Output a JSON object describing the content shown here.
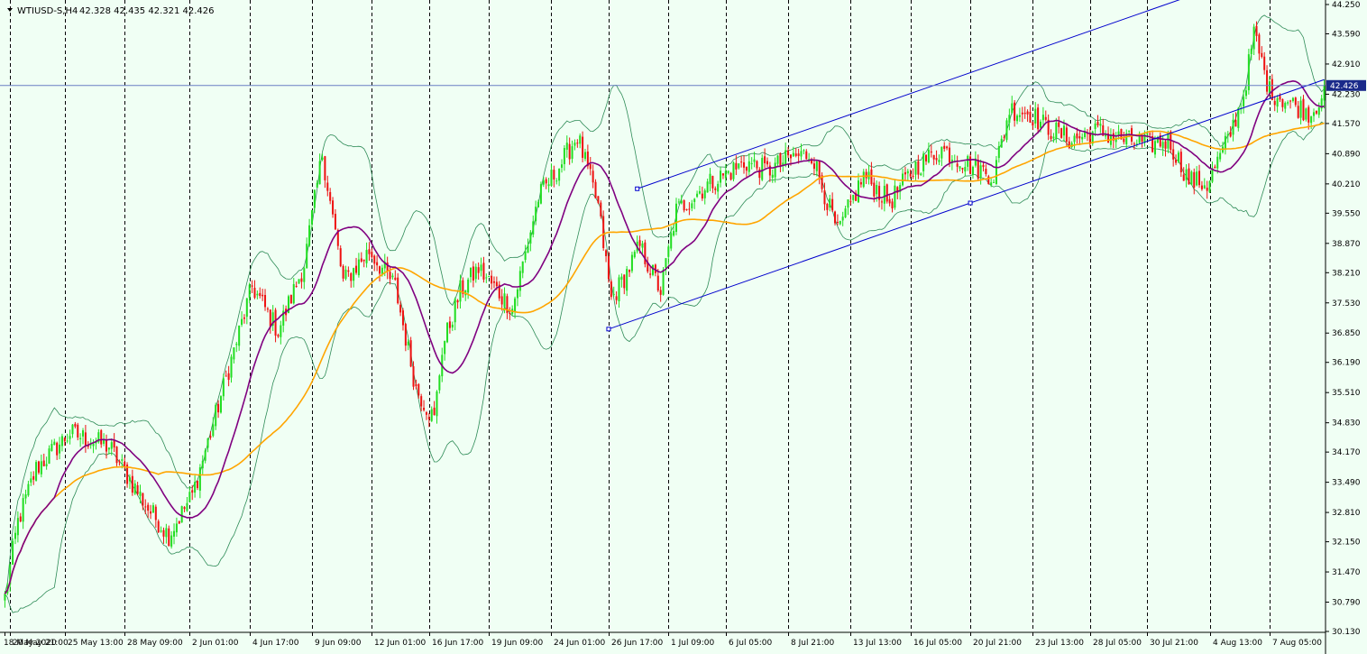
{
  "header": {
    "symbol": "WTIUSD-S,H4",
    "ohlc": "42.328 42.435 42.321 42.426"
  },
  "colors": {
    "background": "#f0fff4",
    "bull": "#22dd22",
    "bear": "#ee1111",
    "sma_fast": "#800080",
    "sma_slow": "#ffa500",
    "bollinger": "#2e8b57",
    "channel": "#0000cd",
    "price_line": "#6a7fc4",
    "price_tag": "#1a2a8a"
  },
  "chart_data": {
    "type": "candlestick",
    "symbol": "WTIUSD-S",
    "timeframe": "H4",
    "last_price": 42.426,
    "ylim": [
      30.13,
      44.25
    ],
    "y_ticks": [
      "44.250",
      "43.590",
      "42.910",
      "42.230",
      "41.570",
      "40.890",
      "40.210",
      "39.550",
      "38.870",
      "38.210",
      "37.530",
      "36.850",
      "36.190",
      "35.510",
      "34.830",
      "34.170",
      "33.490",
      "32.810",
      "32.150",
      "31.470",
      "30.790",
      "30.130"
    ],
    "x_ticks": [
      "18 May 2020",
      "20 May 21:00",
      "25 May 13:00",
      "28 May 09:00",
      "2 Jun 01:00",
      "4 Jun 17:00",
      "9 Jun 09:00",
      "12 Jun 01:00",
      "16 Jun 17:00",
      "19 Jun 09:00",
      "24 Jun 01:00",
      "26 Jun 17:00",
      "1 Jul 09:00",
      "6 Jul 05:00",
      "8 Jul 21:00",
      "13 Jul 13:00",
      "16 Jul 05:00",
      "20 Jul 21:00",
      "23 Jul 13:00",
      "28 Jul 05:00",
      "30 Jul 21:00",
      "4 Aug 13:00",
      "7 Aug 05:00"
    ],
    "period_separators": [
      2,
      23,
      46,
      71,
      94,
      118,
      141,
      163,
      186,
      210,
      232,
      255,
      277,
      301,
      325,
      348,
      371,
      395,
      417,
      439,
      463,
      486
    ],
    "n_candles": 508,
    "price_anchors": [
      [
        0,
        30.9
      ],
      [
        5,
        32.6
      ],
      [
        12,
        33.8
      ],
      [
        25,
        34.6
      ],
      [
        40,
        34.3
      ],
      [
        55,
        32.9
      ],
      [
        63,
        32.3
      ],
      [
        72,
        33.2
      ],
      [
        80,
        34.8
      ],
      [
        95,
        37.9
      ],
      [
        105,
        36.9
      ],
      [
        115,
        38.4
      ],
      [
        122,
        40.9
      ],
      [
        130,
        38.0
      ],
      [
        140,
        38.7
      ],
      [
        150,
        37.9
      ],
      [
        158,
        35.6
      ],
      [
        165,
        34.9
      ],
      [
        168,
        36.5
      ],
      [
        175,
        37.8
      ],
      [
        182,
        38.3
      ],
      [
        195,
        37.4
      ],
      [
        205,
        39.9
      ],
      [
        213,
        40.6
      ],
      [
        220,
        41.3
      ],
      [
        228,
        39.7
      ],
      [
        233,
        37.6
      ],
      [
        238,
        38.1
      ],
      [
        244,
        38.8
      ],
      [
        252,
        37.8
      ],
      [
        258,
        39.6
      ],
      [
        270,
        40.2
      ],
      [
        285,
        40.7
      ],
      [
        293,
        40.5
      ],
      [
        302,
        40.8
      ],
      [
        310,
        40.9
      ],
      [
        320,
        39.1
      ],
      [
        330,
        40.4
      ],
      [
        340,
        39.8
      ],
      [
        350,
        40.6
      ],
      [
        360,
        41.0
      ],
      [
        372,
        40.6
      ],
      [
        380,
        40.4
      ],
      [
        386,
        41.9
      ],
      [
        394,
        41.8
      ],
      [
        400,
        41.5
      ],
      [
        410,
        41.2
      ],
      [
        420,
        41.4
      ],
      [
        430,
        41.2
      ],
      [
        440,
        41.1
      ],
      [
        447,
        41.2
      ],
      [
        455,
        40.3
      ],
      [
        462,
        40.2
      ],
      [
        470,
        41.2
      ],
      [
        476,
        42.2
      ],
      [
        480,
        43.6
      ],
      [
        486,
        42.3
      ],
      [
        495,
        42.0
      ],
      [
        502,
        41.8
      ],
      [
        508,
        42.43
      ]
    ],
    "series": [
      {
        "type": "sma",
        "period": 20
      },
      {
        "type": "sma",
        "period": 60
      },
      {
        "type": "bollinger",
        "period": 20,
        "k": 2
      }
    ],
    "channel": {
      "lower": [
        [
          232,
          36.94
        ],
        [
          371,
          39.78
        ]
      ],
      "upper_anchor": [
        [
          243,
          40.1
        ]
      ]
    },
    "grid": {
      "horizontal": false,
      "vertical": "period-separators"
    }
  }
}
